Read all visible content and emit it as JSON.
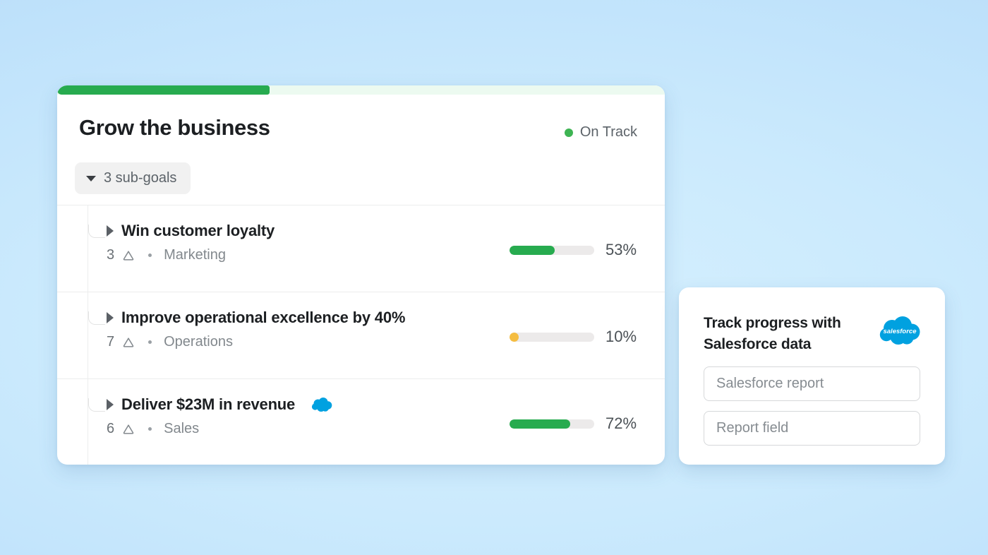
{
  "background": {
    "color": "#c4e6fc"
  },
  "goal_card": {
    "overall_progress_pct": 35,
    "progress_fill_color": "#27ab4f",
    "progress_track_color": "#ecfaf0",
    "title": "Grow the business",
    "status": {
      "label": "On Track",
      "dot_color": "#3eb453"
    },
    "subgoals_chip": {
      "label": "3 sub-goals",
      "icon": "chevron-down-icon"
    },
    "rows": [
      {
        "caret": "caret-right-icon",
        "title": "Win customer loyalty",
        "count": "3",
        "goal_icon": "goal-triangle-icon",
        "team": "Marketing",
        "progress_pct": 53,
        "progress_label": "53%",
        "progress_color": "#27ab4f",
        "has_salesforce_badge": false
      },
      {
        "caret": "caret-right-icon",
        "title": "Improve operational excellence by 40%",
        "count": "7",
        "goal_icon": "goal-triangle-icon",
        "team": "Operations",
        "progress_pct": 10,
        "progress_label": "10%",
        "progress_color": "#f5bd41",
        "has_salesforce_badge": false
      },
      {
        "caret": "caret-right-icon",
        "title": "Deliver $23M in revenue",
        "count": "6",
        "goal_icon": "goal-triangle-icon",
        "team": "Sales",
        "progress_pct": 72,
        "progress_label": "72%",
        "progress_color": "#27ab4f",
        "has_salesforce_badge": true,
        "salesforce_badge_color": "#00a1e0"
      }
    ]
  },
  "salesforce_panel": {
    "heading": "Track progress with Salesforce data",
    "logo": {
      "name": "salesforce-logo",
      "wordmark": "salesforce",
      "color": "#00a1e0"
    },
    "fields": [
      {
        "placeholder": "Salesforce report"
      },
      {
        "placeholder": "Report field"
      }
    ]
  }
}
